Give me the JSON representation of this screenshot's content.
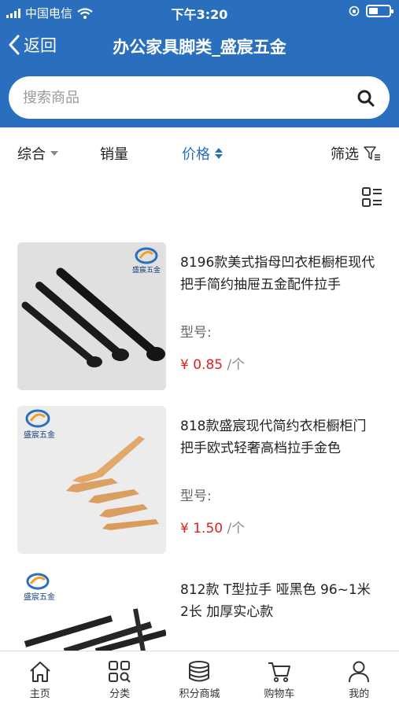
{
  "status": {
    "carrier": "中国电信",
    "time": "下午3:20"
  },
  "nav": {
    "back_label": "返回",
    "title": "办公家具脚类_盛宸五金"
  },
  "search": {
    "placeholder": "搜索商品"
  },
  "sort": {
    "comprehensive": "综合",
    "sales": "销量",
    "price": "价格",
    "filter": "筛选"
  },
  "products": [
    {
      "name": "8196款美式指母凹衣柜橱柜现代把手简约抽屉五金配件拉手",
      "model_label": "型号:",
      "currency": "¥",
      "price": "0.85",
      "unit": "/个",
      "brand_text": "盛宸五金"
    },
    {
      "name": "818款盛宸现代简约衣柜橱柜门把手欧式轻奢高档拉手金色",
      "model_label": "型号:",
      "currency": "¥",
      "price": "1.50",
      "unit": "/个",
      "brand_text": "盛宸五金"
    },
    {
      "name": "812款 T型拉手 哑黑色 96~1米2长 加厚实心款",
      "model_label": "",
      "currency": "",
      "price": "",
      "unit": "",
      "brand_text": "盛宸五金"
    }
  ],
  "tabbar": [
    {
      "label": "主页",
      "icon": "home-icon"
    },
    {
      "label": "分类",
      "icon": "category-icon"
    },
    {
      "label": "积分商城",
      "icon": "points-mall-icon"
    },
    {
      "label": "购物车",
      "icon": "cart-icon"
    },
    {
      "label": "我的",
      "icon": "user-icon"
    }
  ],
  "colors": {
    "primary": "#2a6fbe",
    "price": "#e02020"
  }
}
